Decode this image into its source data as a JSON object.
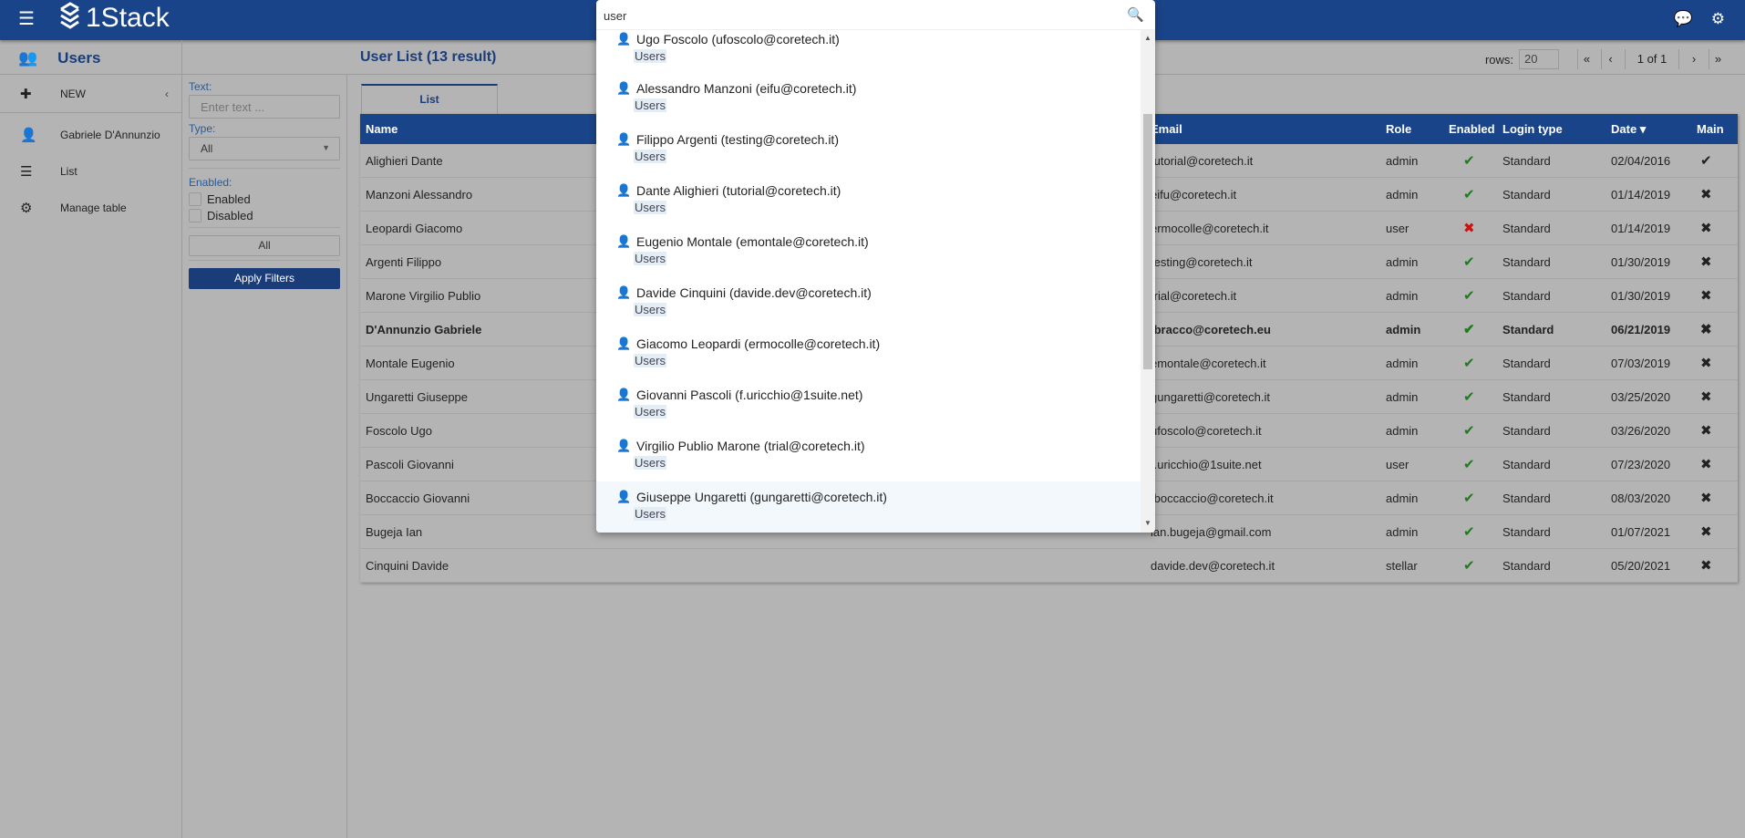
{
  "app": {
    "logo_text": "1Stack"
  },
  "subheader": {
    "section_title": "Users",
    "list_title": "User List (13 result)"
  },
  "sidebar": {
    "items": [
      {
        "label": "NEW",
        "icon": "plus-icon"
      },
      {
        "label": "Gabriele D'Annunzio",
        "icon": "user-icon"
      },
      {
        "label": "List",
        "icon": "list-icon"
      },
      {
        "label": "Manage table",
        "icon": "gears-icon"
      }
    ]
  },
  "filters": {
    "text_label": "Text:",
    "text_placeholder": "Enter text ...",
    "type_label": "Type:",
    "type_value": "All",
    "enabled_label": "Enabled:",
    "enabled_option": "Enabled",
    "disabled_option": "Disabled",
    "all_button": "All",
    "apply_button": "Apply Filters"
  },
  "pager": {
    "rows_label": "rows:",
    "rows_value": "20",
    "page_info": "1 of 1",
    "first": "«",
    "prev": "‹",
    "next": "›",
    "last": "»"
  },
  "tabs": [
    {
      "label": "List"
    }
  ],
  "table": {
    "columns": [
      "Name",
      "Email",
      "Role",
      "Enabled",
      "Login type",
      "Date ▾",
      "Main"
    ],
    "rows": [
      {
        "name": "Alighieri Dante",
        "email": "tutorial@coretech.it",
        "role": "admin",
        "enabled": true,
        "login": "Standard",
        "date": "02/04/2016",
        "main": true,
        "bold": false
      },
      {
        "name": "Manzoni Alessandro",
        "email": "eifu@coretech.it",
        "role": "admin",
        "enabled": true,
        "login": "Standard",
        "date": "01/14/2019",
        "main": false,
        "bold": false
      },
      {
        "name": "Leopardi Giacomo",
        "email": "ermocolle@coretech.it",
        "role": "user",
        "enabled": false,
        "login": "Standard",
        "date": "01/14/2019",
        "main": false,
        "bold": false
      },
      {
        "name": "Argenti Filippo",
        "email": "testing@coretech.it",
        "role": "admin",
        "enabled": true,
        "login": "Standard",
        "date": "01/30/2019",
        "main": false,
        "bold": false
      },
      {
        "name": "Marone Virgilio Publio",
        "email": "trial@coretech.it",
        "role": "admin",
        "enabled": true,
        "login": "Standard",
        "date": "01/30/2019",
        "main": false,
        "bold": false
      },
      {
        "name": "D'Annunzio Gabriele",
        "email": ".bracco@coretech.eu",
        "role": "admin",
        "enabled": true,
        "login": "Standard",
        "date": "06/21/2019",
        "main": false,
        "bold": true
      },
      {
        "name": "Montale Eugenio",
        "email": "emontale@coretech.it",
        "role": "admin",
        "enabled": true,
        "login": "Standard",
        "date": "07/03/2019",
        "main": false,
        "bold": false
      },
      {
        "name": "Ungaretti Giuseppe",
        "email": "gungaretti@coretech.it",
        "role": "admin",
        "enabled": true,
        "login": "Standard",
        "date": "03/25/2020",
        "main": false,
        "bold": false
      },
      {
        "name": "Foscolo Ugo",
        "email": "ufoscolo@coretech.it",
        "role": "admin",
        "enabled": true,
        "login": "Standard",
        "date": "03/26/2020",
        "main": false,
        "bold": false
      },
      {
        "name": "Pascoli Giovanni",
        "email": "f.uricchio@1suite.net",
        "role": "user",
        "enabled": true,
        "login": "Standard",
        "date": "07/23/2020",
        "main": false,
        "bold": false
      },
      {
        "name": "Boccaccio Giovanni",
        "email": ".boccaccio@coretech.it",
        "role": "admin",
        "enabled": true,
        "login": "Standard",
        "date": "08/03/2020",
        "main": false,
        "bold": false
      },
      {
        "name": "Bugeja Ian",
        "email": "ian.bugeja@gmail.com",
        "role": "admin",
        "enabled": true,
        "login": "Standard",
        "date": "01/07/2021",
        "main": false,
        "bold": false
      },
      {
        "name": "Cinquini Davide",
        "email": "davide.dev@coretech.it",
        "role": "stellar",
        "enabled": true,
        "login": "Standard",
        "date": "05/20/2021",
        "main": false,
        "bold": false
      }
    ]
  },
  "search": {
    "value": "user",
    "results": [
      {
        "title": "Ugo Foscolo (ufoscolo@coretech.it)",
        "category": "Users"
      },
      {
        "title": "Alessandro Manzoni (eifu@coretech.it)",
        "category": "Users"
      },
      {
        "title": "Filippo Argenti (testing@coretech.it)",
        "category": "Users"
      },
      {
        "title": "Dante Alighieri (tutorial@coretech.it)",
        "category": "Users"
      },
      {
        "title": "Eugenio Montale (emontale@coretech.it)",
        "category": "Users"
      },
      {
        "title": "Davide Cinquini (davide.dev@coretech.it)",
        "category": "Users"
      },
      {
        "title": "Giacomo Leopardi (ermocolle@coretech.it)",
        "category": "Users"
      },
      {
        "title": "Giovanni Pascoli (f.uricchio@1suite.net)",
        "category": "Users"
      },
      {
        "title": "Virgilio Publio Marone (trial@coretech.it)",
        "category": "Users"
      },
      {
        "title": "Giuseppe Ungaretti (gungaretti@coretech.it)",
        "category": "Users"
      }
    ]
  },
  "colors": {
    "brand": "#1a4489",
    "ok": "#1e7a1e",
    "error": "#cc1111"
  }
}
